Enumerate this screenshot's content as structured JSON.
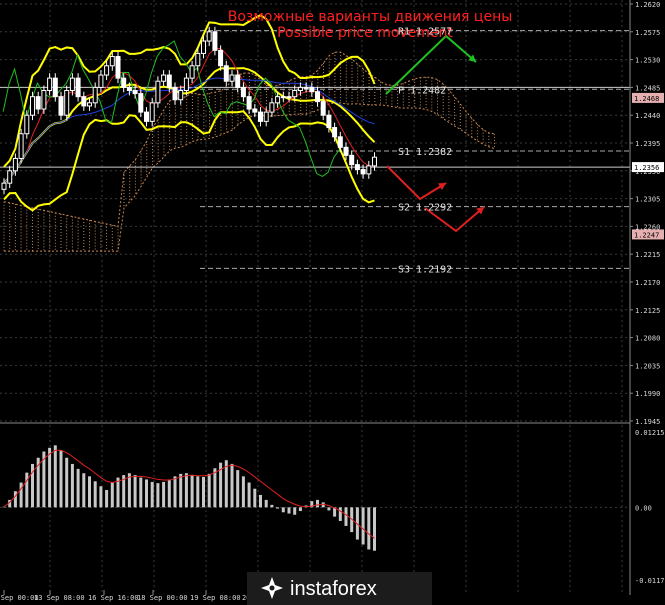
{
  "chart_data": {
    "type": "line",
    "title_ru": "Возможные варианты движения цены",
    "title_en": "Possible price movement",
    "price_axis_labels": [
      "1.2620",
      "1.2575",
      "1.2530",
      "1.2485",
      "1.2440",
      "1.2395",
      "1.2350",
      "1.2305",
      "1.2260",
      "1.2215",
      "1.2170",
      "1.2125",
      "1.2080",
      "1.2035",
      "1.1990",
      "1.1945"
    ],
    "price_ylim": [
      1.1945,
      1.262
    ],
    "tags": [
      {
        "text": "1.2468",
        "value": 1.2468,
        "color": "#e7b0b0",
        "text_color": "#000000"
      },
      {
        "text": "1.2356",
        "value": 1.2356,
        "color": "#ffffff",
        "text_color": "#000000"
      },
      {
        "text": "1.2247",
        "value": 1.2247,
        "color": "#e7b0b0",
        "text_color": "#000000"
      }
    ],
    "pivot_levels": [
      {
        "name": "R1",
        "text": "R1 1.2577",
        "value": 1.2577
      },
      {
        "name": "P",
        "text": "P 1.2482",
        "value": 1.2482
      },
      {
        "name": "S1",
        "text": "S1 1.2382",
        "value": 1.2382
      },
      {
        "name": "S2",
        "text": "S2 1.2292",
        "value": 1.2292
      },
      {
        "name": "S3",
        "text": "S3 1.2192",
        "value": 1.2192
      }
    ],
    "x_labels": [
      "12 Sep 00:00",
      "13 Sep 08:00",
      "16 Sep 16:00",
      "18 Sep 00:00",
      "19 Sep 08:00",
      "20 Se"
    ],
    "close": [
      1.233,
      1.235,
      1.237,
      1.241,
      1.244,
      1.247,
      1.245,
      1.248,
      1.25,
      1.247,
      1.244,
      1.248,
      1.25,
      1.247,
      1.2455,
      1.246,
      1.2485,
      1.2505,
      1.252,
      1.2535,
      1.25,
      1.2485,
      1.248,
      1.2475,
      1.2445,
      1.243,
      1.246,
      1.2495,
      1.2505,
      1.2485,
      1.2465,
      1.248,
      1.25,
      1.252,
      1.254,
      1.256,
      1.2575,
      1.2545,
      1.252,
      1.2495,
      1.2505,
      1.2485,
      1.247,
      1.245,
      1.2445,
      1.243,
      1.2445,
      1.246,
      1.247,
      1.247,
      1.247,
      1.248,
      1.2485,
      1.2485,
      1.2478,
      1.2462,
      1.244,
      1.242,
      1.2405,
      1.2388,
      1.2375,
      1.236,
      1.2352,
      1.2345,
      1.2358,
      1.2372
    ],
    "osc_axis_labels": [
      "0.01215",
      "0.00",
      "-0.01172"
    ],
    "osc_ylim": [
      -0.01172,
      0.01215
    ],
    "osc_values": [
      0.0001,
      0.0012,
      0.0026,
      0.004,
      0.0056,
      0.007,
      0.008,
      0.009,
      0.0096,
      0.01,
      0.0092,
      0.008,
      0.007,
      0.0062,
      0.0055,
      0.005,
      0.0042,
      0.0034,
      0.0028,
      0.004,
      0.0048,
      0.0052,
      0.0055,
      0.0052,
      0.0048,
      0.0045,
      0.0041,
      0.0039,
      0.0041,
      0.0045,
      0.005,
      0.0054,
      0.0055,
      0.0052,
      0.005,
      0.0049,
      0.0054,
      0.0063,
      0.0072,
      0.0076,
      0.007,
      0.006,
      0.005,
      0.004,
      0.003,
      0.002,
      0.0012,
      0.0004,
      -0.0002,
      -0.0008,
      -0.001,
      -0.0012,
      -0.0006,
      0.0003,
      0.001,
      0.0012,
      0.0008,
      -0.0005,
      -0.0015,
      -0.0022,
      -0.003,
      -0.004,
      -0.0052,
      -0.006,
      -0.0068,
      -0.007
    ],
    "osc_signal": [
      0.0001,
      0.0008,
      0.0018,
      0.003,
      0.0043,
      0.0057,
      0.0068,
      0.0078,
      0.0086,
      0.0092,
      0.0092,
      0.0088,
      0.0082,
      0.0075,
      0.0068,
      0.0062,
      0.0055,
      0.0048,
      0.0042,
      0.004,
      0.0042,
      0.0045,
      0.0049,
      0.005,
      0.005,
      0.0049,
      0.0047,
      0.0045,
      0.0044,
      0.0044,
      0.0046,
      0.0049,
      0.0051,
      0.0052,
      0.0051,
      0.0051,
      0.0052,
      0.0056,
      0.0061,
      0.0066,
      0.0068,
      0.0066,
      0.0062,
      0.0056,
      0.0049,
      0.0042,
      0.0035,
      0.0028,
      0.0021,
      0.0014,
      0.0009,
      0.0005,
      0.0002,
      0.0001,
      0.0002,
      0.0004,
      0.0005,
      0.0003,
      -0.0001,
      -0.0006,
      -0.0012,
      -0.0019,
      -0.0027,
      -0.0035,
      -0.0043,
      -0.005
    ]
  },
  "logo": {
    "text": "instaforex"
  },
  "colors": {
    "background": "#000000",
    "grid": "#3a3a3a",
    "price": "#ffffff",
    "bollinger": "#ffff00",
    "ma_red": "#e02020",
    "ma_blue": "#2040e0",
    "chikou": "#20c020",
    "cloud": "#c88850",
    "up_arrow": "#20c020",
    "down_arrow": "#e02020",
    "pivot_line": "#aaaaaa"
  }
}
